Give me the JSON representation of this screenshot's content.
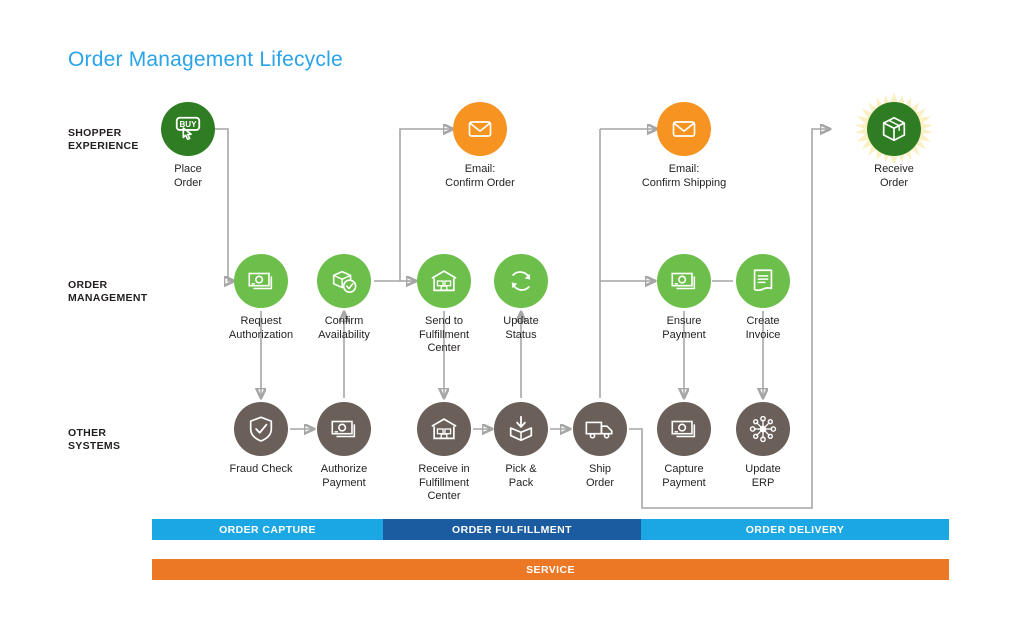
{
  "title": "Order Management Lifecycle",
  "accent_colors": {
    "title_blue": "#2aa3e8",
    "green": "#6dbf4b",
    "dark_green": "#2e7d22",
    "orange": "#f79421",
    "brown": "#6b6059",
    "light_blue_bar": "#1ba7e4",
    "dark_blue_bar": "#1b5ba0",
    "orange_bar": "#ec7725",
    "connector": "#a6a6a6",
    "burst": "#fbf0c4"
  },
  "lanes": [
    {
      "id": "shopper",
      "label": "SHOPPER\nEXPERIENCE"
    },
    {
      "id": "order_mgmt",
      "label": "ORDER\nMANAGEMENT"
    },
    {
      "id": "other",
      "label": "OTHER\nSYSTEMS"
    }
  ],
  "nodes": [
    {
      "id": "place-order",
      "label": "Place\nOrder",
      "lane": "shopper",
      "color": "dark_green",
      "icon": "buy-button-cursor-icon"
    },
    {
      "id": "email-confirm-order",
      "label": "Email:\nConfirm Order",
      "lane": "shopper",
      "color": "orange",
      "icon": "envelope-icon"
    },
    {
      "id": "email-confirm-ship",
      "label": "Email:\nConfirm Shipping",
      "lane": "shopper",
      "color": "orange",
      "icon": "envelope-icon"
    },
    {
      "id": "receive-order",
      "label": "Receive\nOrder",
      "lane": "shopper",
      "color": "dark_green",
      "icon": "package-box-icon"
    },
    {
      "id": "request-authorization",
      "label": "Request\nAuthorization",
      "lane": "order_mgmt",
      "color": "green",
      "icon": "banknote-icon"
    },
    {
      "id": "confirm-availability",
      "label": "Confirm\nAvailability",
      "lane": "order_mgmt",
      "color": "green",
      "icon": "box-check-icon"
    },
    {
      "id": "send-to-fulfillment",
      "label": "Send to\nFulfillment\nCenter",
      "lane": "order_mgmt",
      "color": "green",
      "icon": "warehouse-icon"
    },
    {
      "id": "update-status",
      "label": "Update\nStatus",
      "lane": "order_mgmt",
      "color": "green",
      "icon": "refresh-cycle-icon"
    },
    {
      "id": "ensure-payment",
      "label": "Ensure\nPayment",
      "lane": "order_mgmt",
      "color": "green",
      "icon": "banknote-icon"
    },
    {
      "id": "create-invoice",
      "label": "Create\nInvoice",
      "lane": "order_mgmt",
      "color": "green",
      "icon": "document-lines-icon"
    },
    {
      "id": "fraud-check",
      "label": "Fraud Check",
      "lane": "other",
      "color": "brown",
      "icon": "shield-check-icon"
    },
    {
      "id": "authorize-payment",
      "label": "Authorize\nPayment",
      "lane": "other",
      "color": "brown",
      "icon": "banknote-icon"
    },
    {
      "id": "receive-in-fulfillment",
      "label": "Receive in\nFulfillment\nCenter",
      "lane": "other",
      "color": "brown",
      "icon": "warehouse-icon"
    },
    {
      "id": "pick-and-pack",
      "label": "Pick &\nPack",
      "lane": "other",
      "color": "brown",
      "icon": "box-arrow-down-icon"
    },
    {
      "id": "ship-order",
      "label": "Ship\nOrder",
      "lane": "other",
      "color": "brown",
      "icon": "delivery-truck-icon"
    },
    {
      "id": "capture-payment",
      "label": "Capture\nPayment",
      "lane": "other",
      "color": "brown",
      "icon": "banknote-icon"
    },
    {
      "id": "update-erp",
      "label": "Update\nERP",
      "lane": "other",
      "color": "brown",
      "icon": "network-hub-icon"
    }
  ],
  "phase_bars": [
    {
      "id": "order-capture",
      "label": "ORDER CAPTURE",
      "style": "light_blue"
    },
    {
      "id": "order-fulfillment",
      "label": "ORDER FULFILLMENT",
      "style": "dark_blue"
    },
    {
      "id": "order-delivery",
      "label": "ORDER DELIVERY",
      "style": "light_blue"
    }
  ],
  "service_bar": {
    "id": "service",
    "label": "SERVICE",
    "style": "orange"
  }
}
